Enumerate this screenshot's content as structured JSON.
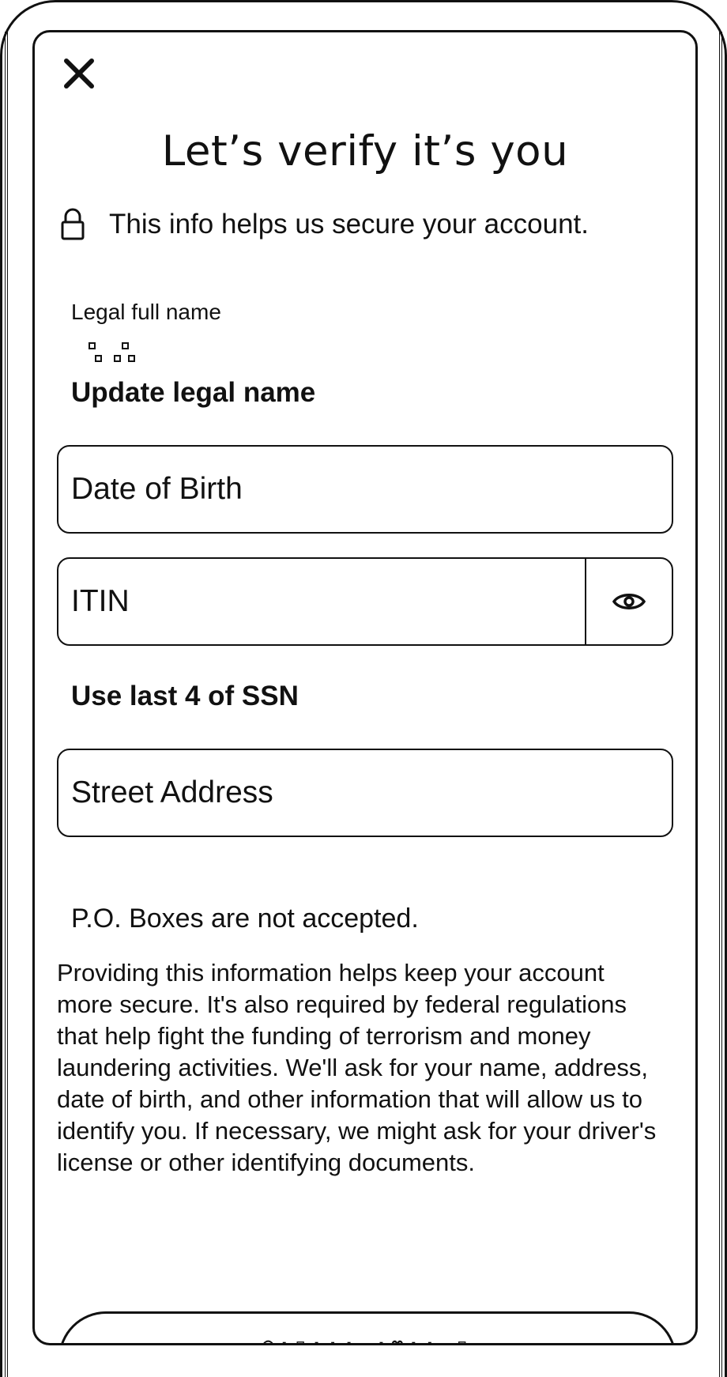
{
  "header": {
    "title": "Let’s verify it’s you",
    "info_text": "This info helps us secure your account."
  },
  "legal_name": {
    "label": "Legal full name",
    "update_link": "Update legal name"
  },
  "fields": {
    "dob_placeholder": "Date of Birth",
    "itin_placeholder": "ITIN",
    "use_ssn_link": "Use last 4 of SSN",
    "street_placeholder": "Street Address",
    "street_helper": "P.O. Boxes are not accepted."
  },
  "disclaimer": "Providing this information helps keep your account more secure. It's also required by federal regulations that help fight the funding of terrorism and money laundering activities. We'll ask for your name, address, date of birth, and other information that will allow us to identify you. If necessary, we might ask for your driver's license or other identifying documents.",
  "icons": {
    "close": "close-icon",
    "lock": "lock-icon",
    "eye": "eye-icon"
  },
  "colors": {
    "text": "#111111",
    "background": "#ffffff",
    "border": "#111111"
  }
}
